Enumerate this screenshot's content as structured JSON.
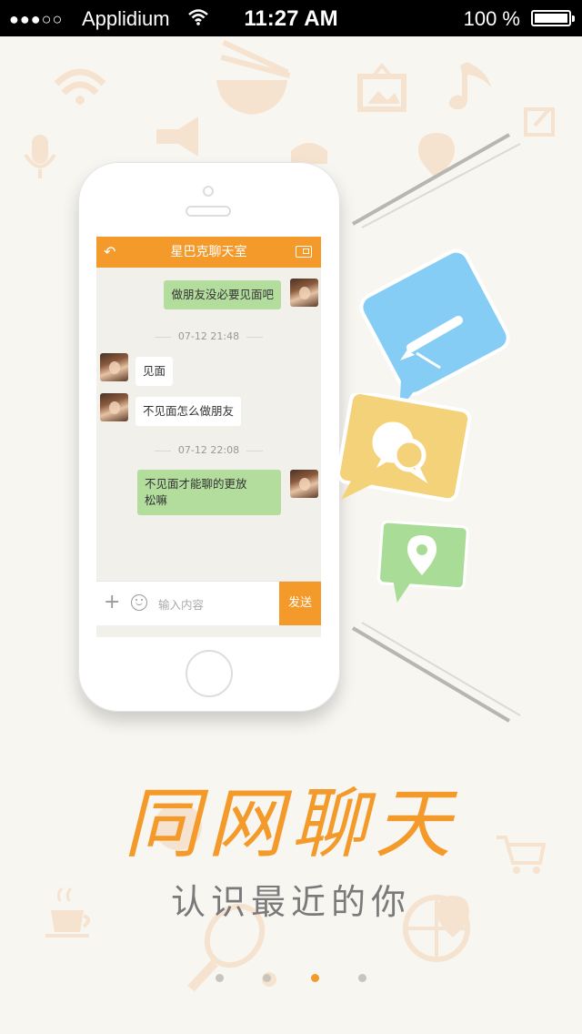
{
  "status_bar": {
    "signal": "●●●○○",
    "carrier": "Applidium",
    "time": "11:27 AM",
    "battery": "100 %"
  },
  "chat": {
    "title": "星巴克聊天室",
    "messages": [
      {
        "side": "me",
        "text": "做朋友没必要见面吧"
      },
      {
        "side": "them",
        "text": "见面"
      },
      {
        "side": "them",
        "text": "不见面怎么做朋友"
      },
      {
        "side": "me",
        "text": "不见面才能聊的更放松嘛"
      }
    ],
    "message_me_last_lines": [
      "不见面才能聊的更放",
      "松嘛"
    ],
    "timestamps": [
      "07-12 21:48",
      "07-12 22:08"
    ],
    "input_placeholder": "输入内容",
    "send_label": "发送"
  },
  "feature_icons": [
    "pencil-icon",
    "chat-bubbles-icon",
    "location-pin-icon"
  ],
  "headline": "同网聊天",
  "subline": "认识最近的你",
  "pagination": {
    "count": 4,
    "active_index": 2
  },
  "colors": {
    "accent": "#f39a2b",
    "blue": "#86cdf5",
    "yellow": "#f3d27a",
    "green": "#a9dc96",
    "bubble_me": "#b3dd9d"
  }
}
